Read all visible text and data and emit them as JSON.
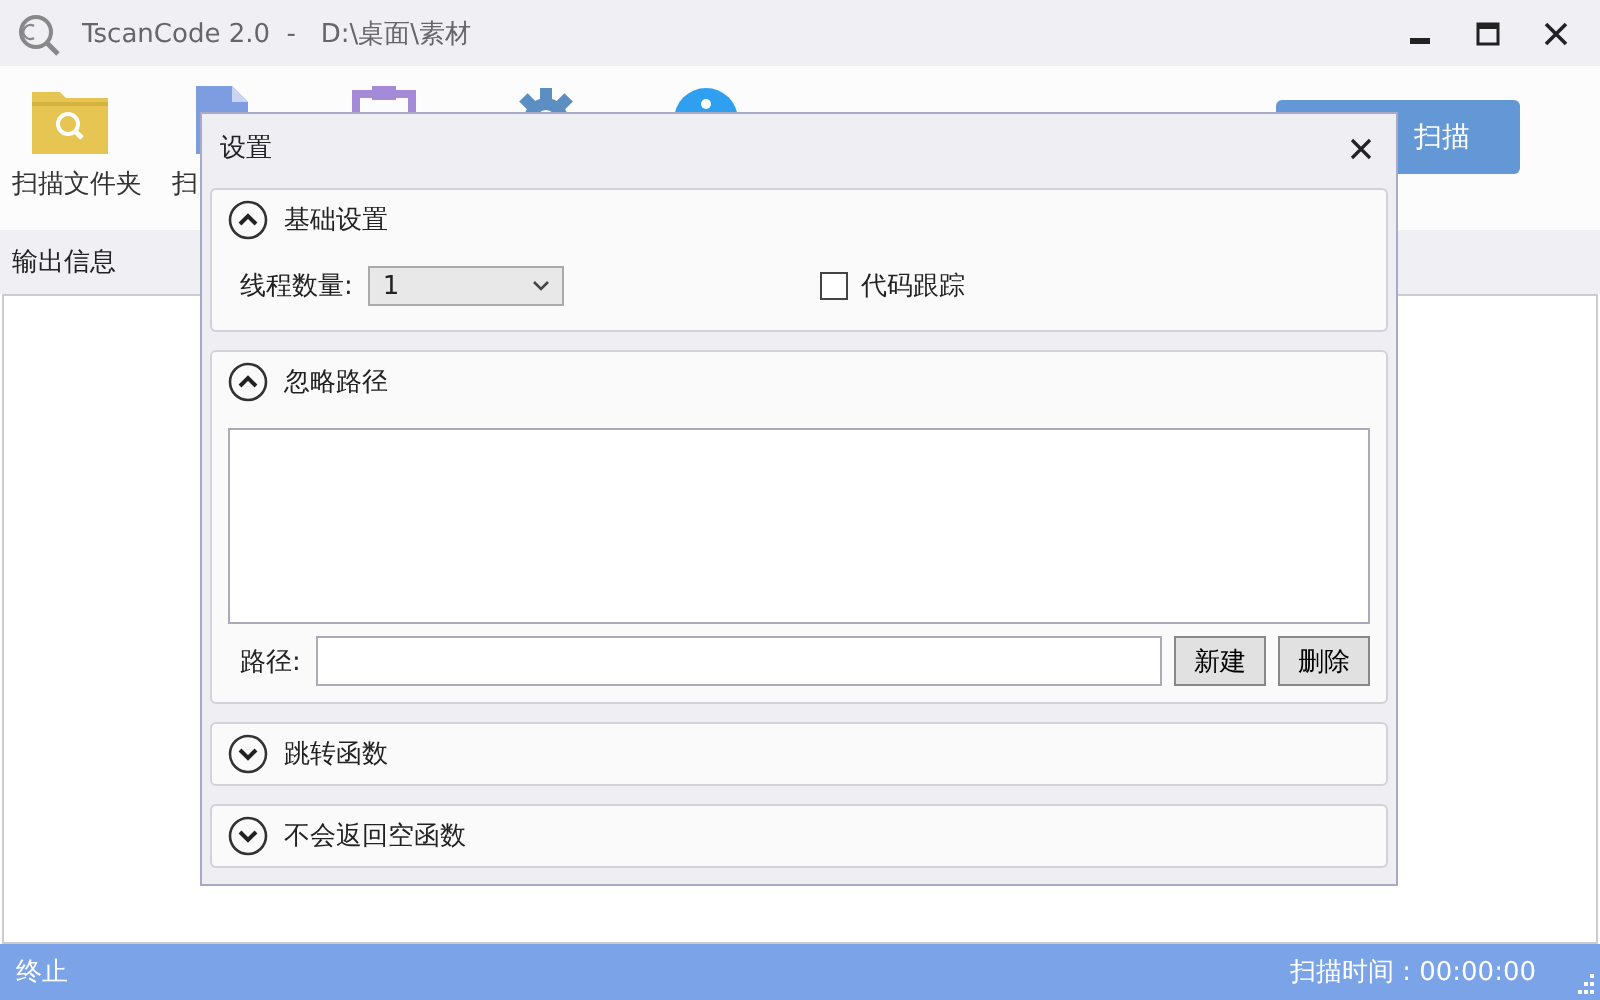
{
  "window": {
    "title": "TscanCode 2.0  -   D:\\桌面\\素材"
  },
  "toolbar": [
    {
      "kind": "folder",
      "label": "扫描文件夹"
    },
    {
      "kind": "file",
      "label": "扫"
    },
    {
      "kind": "clipboard"
    },
    {
      "kind": "gear"
    },
    {
      "kind": "info"
    }
  ],
  "scan_button": "扫描",
  "output": {
    "label": "输出信息"
  },
  "status_bar": {
    "left": "终止",
    "right": "扫描时间 : 00:00:00"
  },
  "dialog": {
    "title": "设置",
    "sections": [
      {
        "kind": "basic",
        "title": "基础设置",
        "expanded": true,
        "thread_label": "线程数量:",
        "thread_value": "1",
        "trace": {
          "label": "代码跟踪",
          "checked": false
        }
      },
      {
        "kind": "paths",
        "title": "忽略路径",
        "expanded": true,
        "path_label": "路径:",
        "buttons": [
          "新建",
          "删除"
        ]
      },
      {
        "kind": "plain",
        "title": "跳转函数",
        "expanded": false
      },
      {
        "kind": "plain",
        "title": "不会返回空函数",
        "expanded": false
      }
    ]
  }
}
